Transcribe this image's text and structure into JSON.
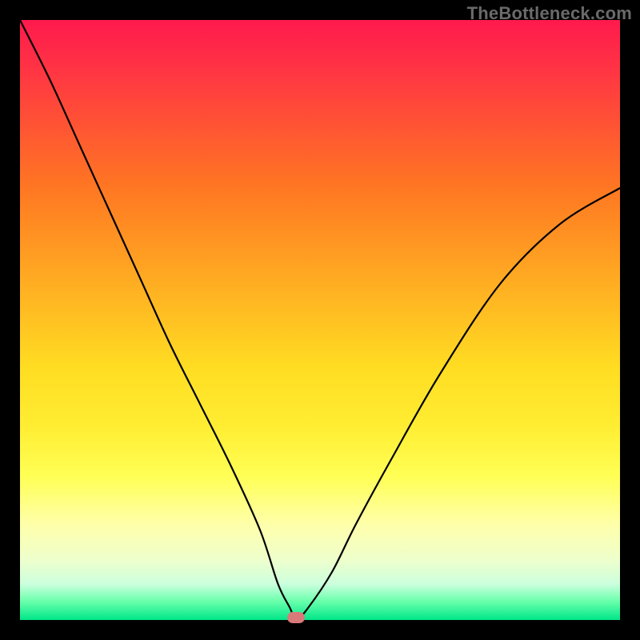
{
  "watermark": "TheBottleneck.com",
  "chart_data": {
    "type": "line",
    "title": "",
    "xlabel": "",
    "ylabel": "",
    "xlim": [
      0,
      100
    ],
    "ylim": [
      0,
      100
    ],
    "grid": false,
    "legend": false,
    "series": [
      {
        "name": "bottleneck-curve",
        "x": [
          0,
          5,
          10,
          15,
          20,
          25,
          30,
          35,
          40,
          43,
          45,
          46,
          48,
          52,
          56,
          62,
          70,
          80,
          90,
          100
        ],
        "y": [
          100,
          90,
          79,
          68,
          57,
          46,
          36,
          26,
          15,
          6,
          2,
          0,
          2,
          8,
          16,
          27,
          41,
          56,
          66,
          72
        ]
      }
    ],
    "marker": {
      "x": 46,
      "y": 0,
      "color": "#d87a7a"
    },
    "background_gradient": {
      "type": "vertical",
      "stops": [
        {
          "pos": 0.0,
          "color": "#ff1a4d"
        },
        {
          "pos": 0.5,
          "color": "#ffdd22"
        },
        {
          "pos": 0.85,
          "color": "#ffffaa"
        },
        {
          "pos": 1.0,
          "color": "#00e688"
        }
      ]
    }
  }
}
